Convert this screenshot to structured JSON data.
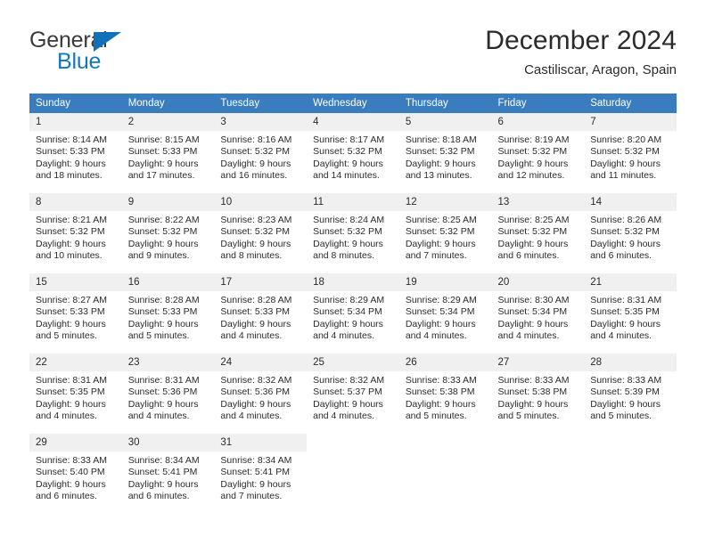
{
  "brand": {
    "name_line1": "General",
    "name_line2": "Blue",
    "accent_color": "#1071b8",
    "logo_icon": "triangle-flag-icon"
  },
  "header": {
    "title": "December 2024",
    "subtitle": "Castiliscar, Aragon, Spain"
  },
  "theme": {
    "header_bg": "#3a7dbf",
    "daynum_bg": "#f0f0f0",
    "text_color": "#2b2b2b"
  },
  "calendar": {
    "weekday_headers": [
      "Sunday",
      "Monday",
      "Tuesday",
      "Wednesday",
      "Thursday",
      "Friday",
      "Saturday"
    ],
    "weeks": [
      [
        {
          "day": "1",
          "sunrise": "Sunrise: 8:14 AM",
          "sunset": "Sunset: 5:33 PM",
          "daylight_l1": "Daylight: 9 hours",
          "daylight_l2": "and 18 minutes."
        },
        {
          "day": "2",
          "sunrise": "Sunrise: 8:15 AM",
          "sunset": "Sunset: 5:33 PM",
          "daylight_l1": "Daylight: 9 hours",
          "daylight_l2": "and 17 minutes."
        },
        {
          "day": "3",
          "sunrise": "Sunrise: 8:16 AM",
          "sunset": "Sunset: 5:32 PM",
          "daylight_l1": "Daylight: 9 hours",
          "daylight_l2": "and 16 minutes."
        },
        {
          "day": "4",
          "sunrise": "Sunrise: 8:17 AM",
          "sunset": "Sunset: 5:32 PM",
          "daylight_l1": "Daylight: 9 hours",
          "daylight_l2": "and 14 minutes."
        },
        {
          "day": "5",
          "sunrise": "Sunrise: 8:18 AM",
          "sunset": "Sunset: 5:32 PM",
          "daylight_l1": "Daylight: 9 hours",
          "daylight_l2": "and 13 minutes."
        },
        {
          "day": "6",
          "sunrise": "Sunrise: 8:19 AM",
          "sunset": "Sunset: 5:32 PM",
          "daylight_l1": "Daylight: 9 hours",
          "daylight_l2": "and 12 minutes."
        },
        {
          "day": "7",
          "sunrise": "Sunrise: 8:20 AM",
          "sunset": "Sunset: 5:32 PM",
          "daylight_l1": "Daylight: 9 hours",
          "daylight_l2": "and 11 minutes."
        }
      ],
      [
        {
          "day": "8",
          "sunrise": "Sunrise: 8:21 AM",
          "sunset": "Sunset: 5:32 PM",
          "daylight_l1": "Daylight: 9 hours",
          "daylight_l2": "and 10 minutes."
        },
        {
          "day": "9",
          "sunrise": "Sunrise: 8:22 AM",
          "sunset": "Sunset: 5:32 PM",
          "daylight_l1": "Daylight: 9 hours",
          "daylight_l2": "and 9 minutes."
        },
        {
          "day": "10",
          "sunrise": "Sunrise: 8:23 AM",
          "sunset": "Sunset: 5:32 PM",
          "daylight_l1": "Daylight: 9 hours",
          "daylight_l2": "and 8 minutes."
        },
        {
          "day": "11",
          "sunrise": "Sunrise: 8:24 AM",
          "sunset": "Sunset: 5:32 PM",
          "daylight_l1": "Daylight: 9 hours",
          "daylight_l2": "and 8 minutes."
        },
        {
          "day": "12",
          "sunrise": "Sunrise: 8:25 AM",
          "sunset": "Sunset: 5:32 PM",
          "daylight_l1": "Daylight: 9 hours",
          "daylight_l2": "and 7 minutes."
        },
        {
          "day": "13",
          "sunrise": "Sunrise: 8:25 AM",
          "sunset": "Sunset: 5:32 PM",
          "daylight_l1": "Daylight: 9 hours",
          "daylight_l2": "and 6 minutes."
        },
        {
          "day": "14",
          "sunrise": "Sunrise: 8:26 AM",
          "sunset": "Sunset: 5:32 PM",
          "daylight_l1": "Daylight: 9 hours",
          "daylight_l2": "and 6 minutes."
        }
      ],
      [
        {
          "day": "15",
          "sunrise": "Sunrise: 8:27 AM",
          "sunset": "Sunset: 5:33 PM",
          "daylight_l1": "Daylight: 9 hours",
          "daylight_l2": "and 5 minutes."
        },
        {
          "day": "16",
          "sunrise": "Sunrise: 8:28 AM",
          "sunset": "Sunset: 5:33 PM",
          "daylight_l1": "Daylight: 9 hours",
          "daylight_l2": "and 5 minutes."
        },
        {
          "day": "17",
          "sunrise": "Sunrise: 8:28 AM",
          "sunset": "Sunset: 5:33 PM",
          "daylight_l1": "Daylight: 9 hours",
          "daylight_l2": "and 4 minutes."
        },
        {
          "day": "18",
          "sunrise": "Sunrise: 8:29 AM",
          "sunset": "Sunset: 5:34 PM",
          "daylight_l1": "Daylight: 9 hours",
          "daylight_l2": "and 4 minutes."
        },
        {
          "day": "19",
          "sunrise": "Sunrise: 8:29 AM",
          "sunset": "Sunset: 5:34 PM",
          "daylight_l1": "Daylight: 9 hours",
          "daylight_l2": "and 4 minutes."
        },
        {
          "day": "20",
          "sunrise": "Sunrise: 8:30 AM",
          "sunset": "Sunset: 5:34 PM",
          "daylight_l1": "Daylight: 9 hours",
          "daylight_l2": "and 4 minutes."
        },
        {
          "day": "21",
          "sunrise": "Sunrise: 8:31 AM",
          "sunset": "Sunset: 5:35 PM",
          "daylight_l1": "Daylight: 9 hours",
          "daylight_l2": "and 4 minutes."
        }
      ],
      [
        {
          "day": "22",
          "sunrise": "Sunrise: 8:31 AM",
          "sunset": "Sunset: 5:35 PM",
          "daylight_l1": "Daylight: 9 hours",
          "daylight_l2": "and 4 minutes."
        },
        {
          "day": "23",
          "sunrise": "Sunrise: 8:31 AM",
          "sunset": "Sunset: 5:36 PM",
          "daylight_l1": "Daylight: 9 hours",
          "daylight_l2": "and 4 minutes."
        },
        {
          "day": "24",
          "sunrise": "Sunrise: 8:32 AM",
          "sunset": "Sunset: 5:36 PM",
          "daylight_l1": "Daylight: 9 hours",
          "daylight_l2": "and 4 minutes."
        },
        {
          "day": "25",
          "sunrise": "Sunrise: 8:32 AM",
          "sunset": "Sunset: 5:37 PM",
          "daylight_l1": "Daylight: 9 hours",
          "daylight_l2": "and 4 minutes."
        },
        {
          "day": "26",
          "sunrise": "Sunrise: 8:33 AM",
          "sunset": "Sunset: 5:38 PM",
          "daylight_l1": "Daylight: 9 hours",
          "daylight_l2": "and 5 minutes."
        },
        {
          "day": "27",
          "sunrise": "Sunrise: 8:33 AM",
          "sunset": "Sunset: 5:38 PM",
          "daylight_l1": "Daylight: 9 hours",
          "daylight_l2": "and 5 minutes."
        },
        {
          "day": "28",
          "sunrise": "Sunrise: 8:33 AM",
          "sunset": "Sunset: 5:39 PM",
          "daylight_l1": "Daylight: 9 hours",
          "daylight_l2": "and 5 minutes."
        }
      ],
      [
        {
          "day": "29",
          "sunrise": "Sunrise: 8:33 AM",
          "sunset": "Sunset: 5:40 PM",
          "daylight_l1": "Daylight: 9 hours",
          "daylight_l2": "and 6 minutes."
        },
        {
          "day": "30",
          "sunrise": "Sunrise: 8:34 AM",
          "sunset": "Sunset: 5:41 PM",
          "daylight_l1": "Daylight: 9 hours",
          "daylight_l2": "and 6 minutes."
        },
        {
          "day": "31",
          "sunrise": "Sunrise: 8:34 AM",
          "sunset": "Sunset: 5:41 PM",
          "daylight_l1": "Daylight: 9 hours",
          "daylight_l2": "and 7 minutes."
        },
        {
          "day": "",
          "sunrise": "",
          "sunset": "",
          "daylight_l1": "",
          "daylight_l2": ""
        },
        {
          "day": "",
          "sunrise": "",
          "sunset": "",
          "daylight_l1": "",
          "daylight_l2": ""
        },
        {
          "day": "",
          "sunrise": "",
          "sunset": "",
          "daylight_l1": "",
          "daylight_l2": ""
        },
        {
          "day": "",
          "sunrise": "",
          "sunset": "",
          "daylight_l1": "",
          "daylight_l2": ""
        }
      ]
    ]
  }
}
